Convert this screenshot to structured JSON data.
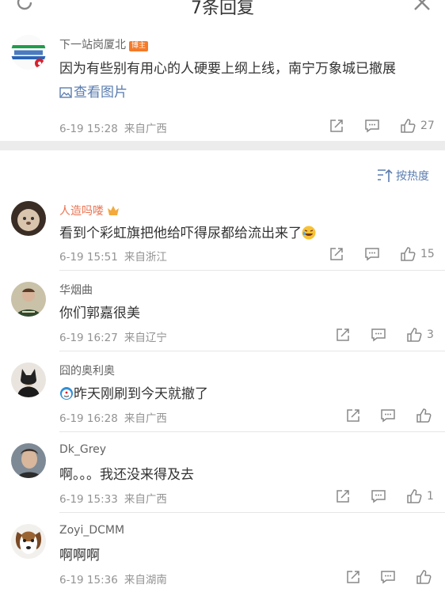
{
  "header": {
    "title": "7条回复",
    "refresh_icon": "refresh-icon",
    "close_icon": "close-icon"
  },
  "post": {
    "author": "下一站岗厦北",
    "badge": "博主",
    "text": "因为有些别有用心的人硬要上纲上线，南宁万象城已撤展",
    "view_image": "查看图片",
    "date": "6-19 15:28",
    "source": "来自广西",
    "likes": "27"
  },
  "sort": {
    "label": "按热度"
  },
  "comments": [
    {
      "name": "人造吗喽",
      "text": "看到个彩虹旗把他给吓得尿都给流出来了",
      "date": "6-19 15:51",
      "source": "来自浙江",
      "likes": "15"
    },
    {
      "name": "华烟曲",
      "text": "你们郭嘉很美",
      "date": "6-19 16:27",
      "source": "来自辽宁",
      "likes": "3"
    },
    {
      "name": "囧的奥利奥",
      "text": "昨天刚刷到今天就撤了",
      "date": "6-19 16:28",
      "source": "来自广西",
      "likes": ""
    },
    {
      "name": "Dk_Grey",
      "text": "啊。。。我还没来得及去",
      "date": "6-19 15:33",
      "source": "来自广西",
      "likes": "1"
    },
    {
      "name": "Zoyi_DCMM",
      "text": "啊啊啊",
      "date": "6-19 15:36",
      "source": "来自湖南",
      "likes": ""
    }
  ],
  "colors": {
    "name_vip": "#eb7350",
    "link": "#5b7db0",
    "meta": "#939393",
    "badge": "#f47a29"
  }
}
